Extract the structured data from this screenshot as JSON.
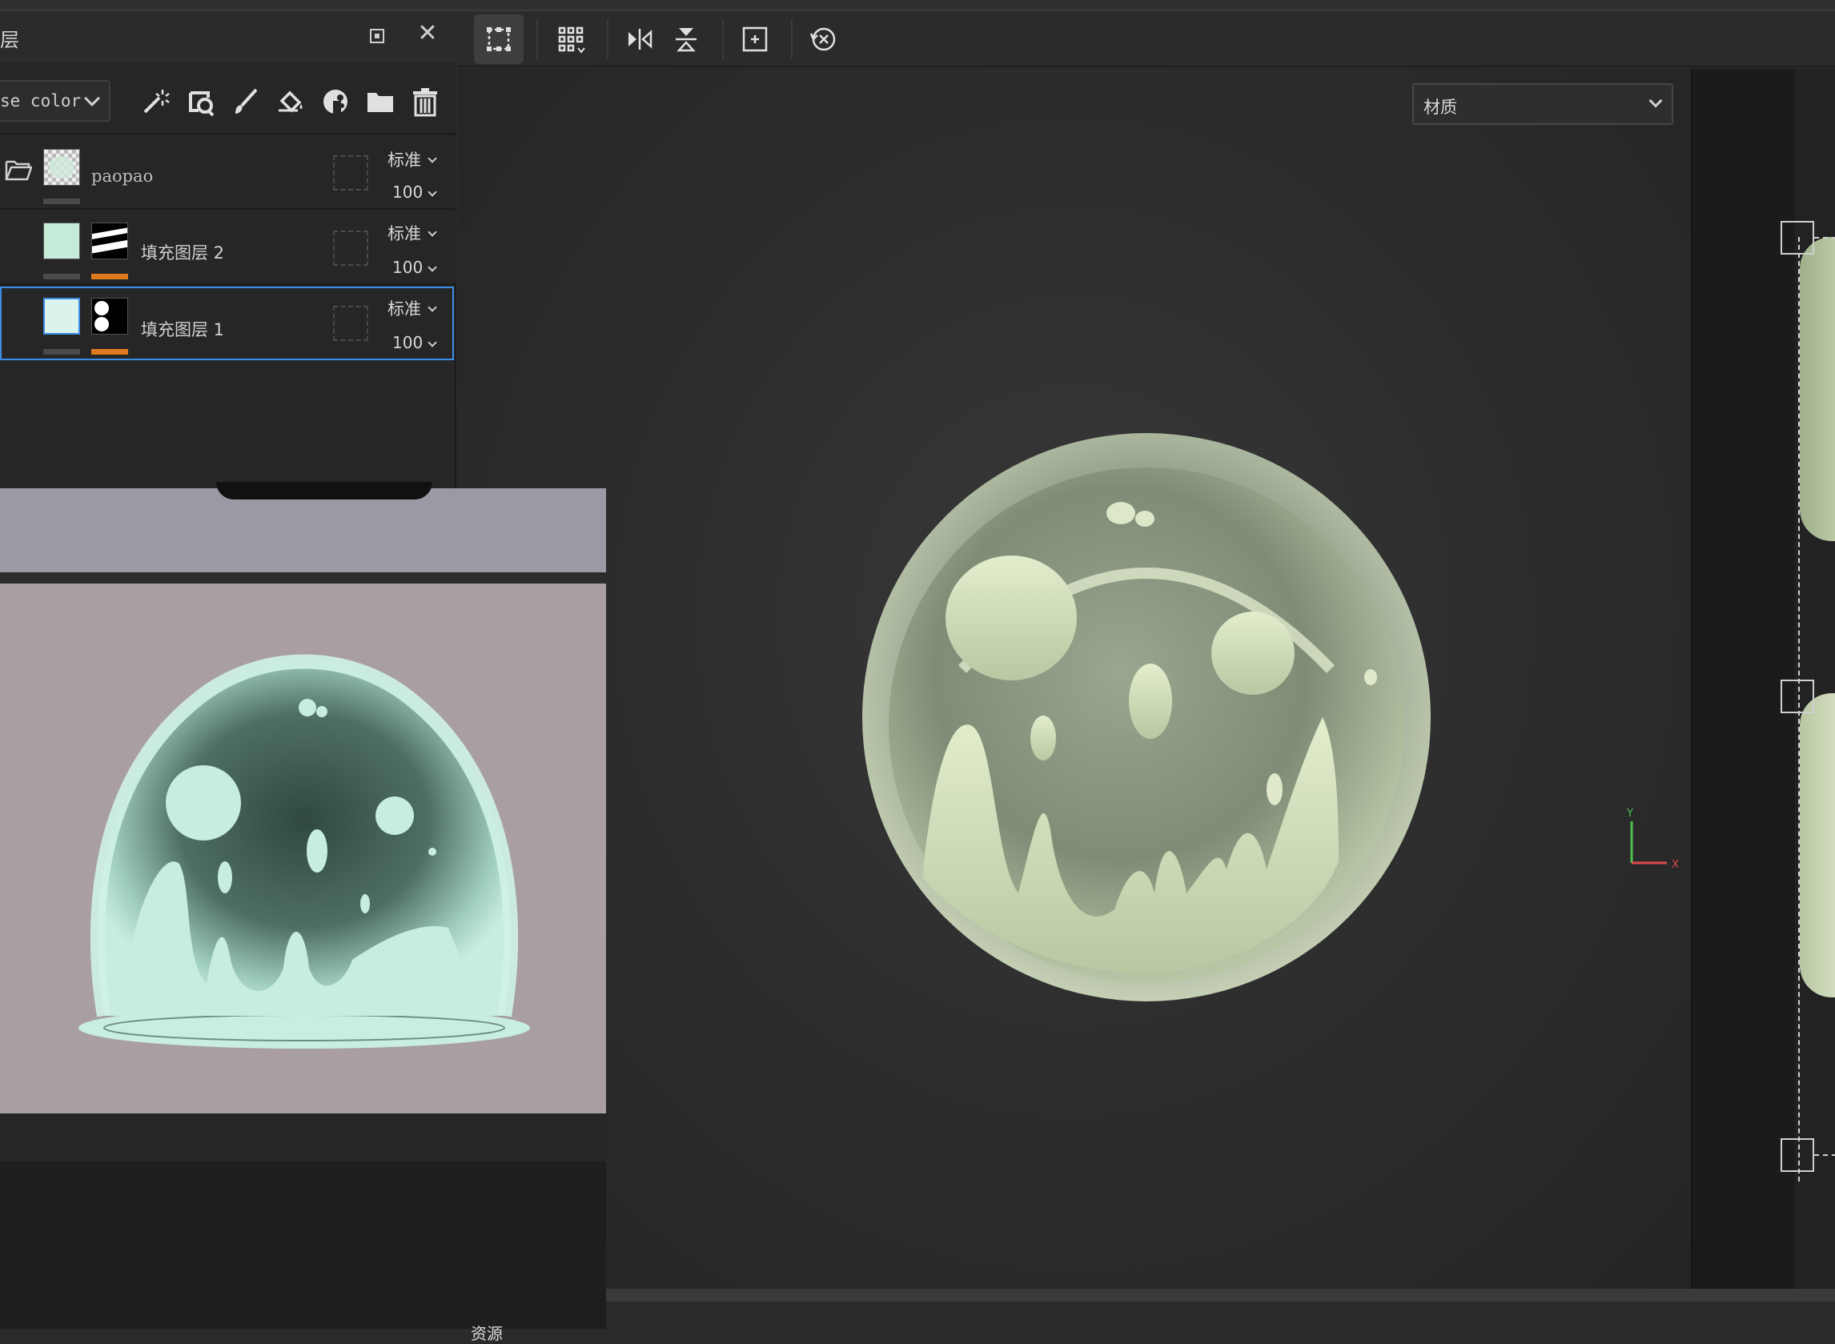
{
  "layers_panel": {
    "title": "层",
    "channel_select": "se color",
    "tools": [
      "magic-wand-icon",
      "smart-mask-icon",
      "paint-brush-icon",
      "fill-bucket-icon",
      "generator-icon",
      "folder-icon",
      "trash-icon"
    ],
    "layers": [
      {
        "name": "paopao",
        "blend": "标准",
        "opacity": "100",
        "type": "folder"
      },
      {
        "name": "填充图层 2",
        "blend": "标准",
        "opacity": "100",
        "type": "fill"
      },
      {
        "name": "填充图层 1",
        "blend": "标准",
        "opacity": "100",
        "type": "fill",
        "selected": true
      }
    ]
  },
  "viewport": {
    "material_select": "材质",
    "toolbar": [
      "selection-icon",
      "grid-icon",
      "mirror-x-icon",
      "mirror-y-icon",
      "frame-icon",
      "reset-view-icon"
    ],
    "axis": {
      "y": "Y",
      "x": "X"
    }
  },
  "colors": {
    "accent": "#3d8ee6",
    "orange": "#e07a1f",
    "bubble": "#c8dcb4",
    "ref_bubble": "#c7ece0"
  },
  "footer": {
    "assets_label": "资源"
  }
}
